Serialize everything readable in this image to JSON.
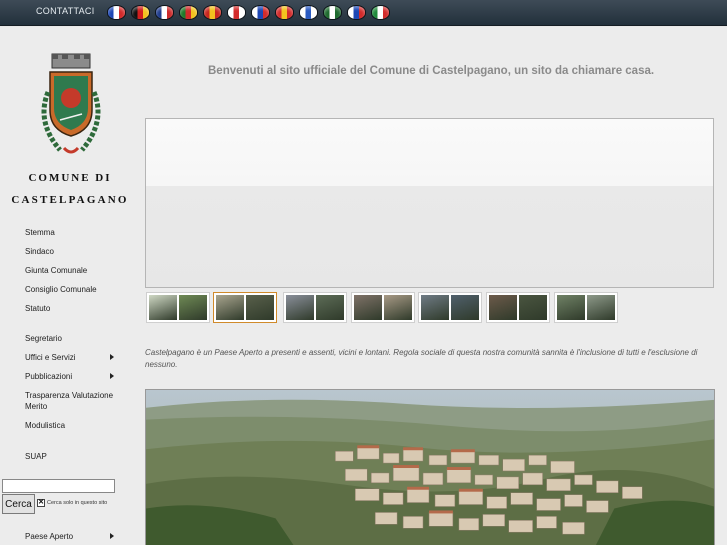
{
  "topbar": {
    "contact_label": "CONTATTACI",
    "flags": [
      {
        "icon": "flag-france-icon",
        "colors": [
          "#1c46b4",
          "#ffffff",
          "#d22b2b"
        ]
      },
      {
        "icon": "flag-germany-icon",
        "colors": [
          "#111111",
          "#d01e1e",
          "#f2c21e"
        ]
      },
      {
        "icon": "flag-uk-icon",
        "colors": [
          "#1f3c8c",
          "#ffffff",
          "#cc2a2a"
        ]
      },
      {
        "icon": "flag-portugal-icon",
        "colors": [
          "#1f7a2a",
          "#d22b2b",
          "#f2c21e"
        ]
      },
      {
        "icon": "flag-spain-icon",
        "colors": [
          "#c8261e",
          "#f2c21e",
          "#c8261e"
        ]
      },
      {
        "icon": "flag-japan-icon",
        "colors": [
          "#ffffff",
          "#d22b2b",
          "#ffffff"
        ]
      },
      {
        "icon": "flag-korea-icon",
        "colors": [
          "#ffffff",
          "#1c46b4",
          "#d22b2b"
        ]
      },
      {
        "icon": "flag-china-icon",
        "colors": [
          "#d22b2b",
          "#f2c21e",
          "#d22b2b"
        ]
      },
      {
        "icon": "flag-israel-icon",
        "colors": [
          "#ffffff",
          "#2a5bc2",
          "#ffffff"
        ]
      },
      {
        "icon": "flag-arabic-icon",
        "colors": [
          "#1e6a2e",
          "#ffffff",
          "#1e6a2e"
        ]
      },
      {
        "icon": "flag-russia-icon",
        "colors": [
          "#ffffff",
          "#1c46b4",
          "#d22b2b"
        ]
      },
      {
        "icon": "flag-italy-icon",
        "colors": [
          "#1f8a3a",
          "#ffffff",
          "#d22b2b"
        ]
      }
    ]
  },
  "sidebar": {
    "comune_di": "COMUNE DI",
    "castelpagano": "CASTELPAGANO",
    "menu": [
      {
        "label": "Stemma",
        "submenu": false
      },
      {
        "label": "Sindaco",
        "submenu": false
      },
      {
        "label": "Giunta Comunale",
        "submenu": false
      },
      {
        "label": "Consiglio Comunale",
        "submenu": false
      },
      {
        "label": "Statuto",
        "submenu": false
      },
      {
        "label": "Segretario",
        "submenu": false
      },
      {
        "label": "Uffici e Servizi",
        "submenu": true
      },
      {
        "label": "Pubblicazioni",
        "submenu": true
      },
      {
        "label": "Trasparenza Valutazione Merito",
        "submenu": false
      },
      {
        "label": "Modulistica",
        "submenu": false
      },
      {
        "label": "SUAP",
        "submenu": false
      },
      {
        "label": "Paese Aperto",
        "submenu": true
      }
    ],
    "search": {
      "value": "",
      "button_label": "Cerca",
      "site_only_label": "Cerca solo in questo sito",
      "site_only_checked": true
    }
  },
  "main": {
    "welcome": "Benvenuti al sito ufficiale del Comune di Castelpagano, un sito da chiamare casa.",
    "intro": "Castelpagano è un Paese Aperto a presenti e assenti, vicini e lontani. Regola sociale di questa nostra comunità sannita è l'inclusione di tutti e l'esclusione di nessuno.",
    "thumbnails": [
      {
        "colors": [
          "#cfd8c4",
          "#6f8a55"
        ],
        "active": false
      },
      {
        "colors": [
          "#a9a58f",
          "#59604b"
        ],
        "active": true
      },
      {
        "colors": [
          "#8a8f9a",
          "#5d6c57"
        ],
        "active": false
      },
      {
        "colors": [
          "#7f7268",
          "#a89a86"
        ],
        "active": false
      },
      {
        "colors": [
          "#6f7b85",
          "#50606c"
        ],
        "active": false
      },
      {
        "colors": [
          "#6c5a4a",
          "#4a5540"
        ],
        "active": false
      },
      {
        "colors": [
          "#708266",
          "#8e9a8a"
        ],
        "active": false
      }
    ]
  }
}
